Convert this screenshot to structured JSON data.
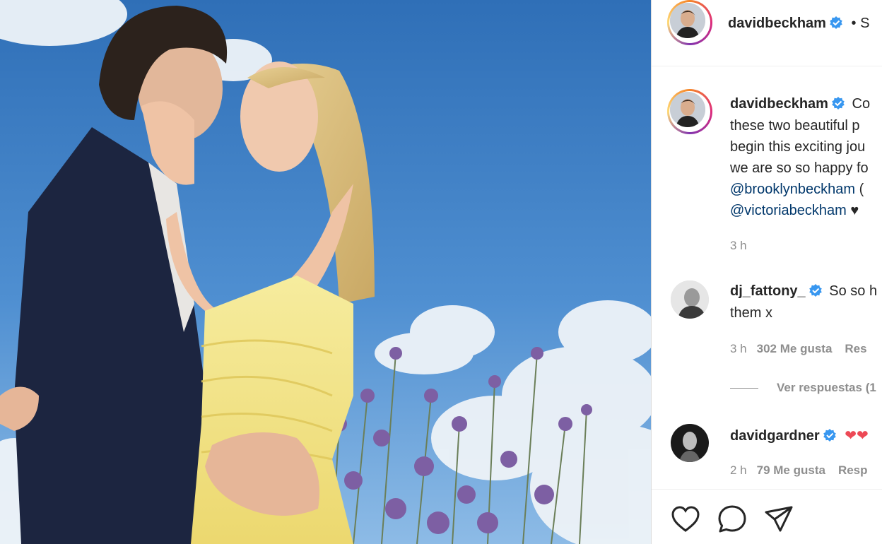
{
  "post": {
    "username": "davidbeckham",
    "follow_partial": "• S"
  },
  "caption": {
    "username": "davidbeckham",
    "lines": [
      "Co",
      "these two beautiful p",
      "begin this exciting jou",
      "we are so so happy fo"
    ],
    "mention1": "@brooklynbeckham",
    "mention1_tail": "(",
    "mention2": "@victoriabeckham",
    "mention2_tail": "♥",
    "time": "3 h"
  },
  "comments": [
    {
      "username": "dj_fattony_",
      "text_line1": "So so h",
      "text_line2": "them x",
      "time": "3 h",
      "likes": "302 Me gusta",
      "reply": "Res",
      "view_replies": "Ver respuestas (1"
    },
    {
      "username": "davidgardner",
      "text": "❤❤",
      "time": "2 h",
      "likes": "79 Me gusta",
      "reply": "Resp"
    }
  ],
  "icons": {
    "like": "heart-icon",
    "comment": "comment-icon",
    "share": "paper-plane-icon",
    "verified": "verified-badge-icon"
  },
  "colors": {
    "verified": "#3897f0",
    "mention": "#00376b",
    "meta": "#8e8e8e",
    "heart_red": "#ed4956"
  }
}
